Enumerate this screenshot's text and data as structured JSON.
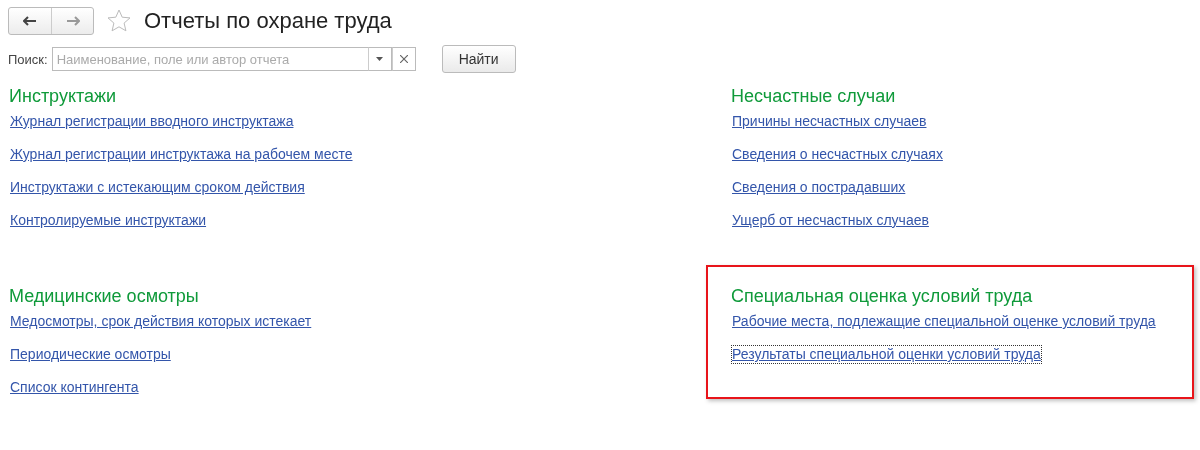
{
  "window": {
    "title": "Отчеты по охране труда",
    "favorite": false
  },
  "search": {
    "label": "Поиск:",
    "placeholder": "Наименование, поле или автор отчета",
    "button": "Найти"
  },
  "groups": [
    {
      "title": "Инструктажи",
      "highlighted": false,
      "links": [
        {
          "text": "Журнал регистрации вводного инструктажа",
          "focused": false
        },
        {
          "text": "Журнал регистрации инструктажа на рабочем месте",
          "focused": false
        },
        {
          "text": "Инструктажи с истекающим сроком действия",
          "focused": false
        },
        {
          "text": "Контролируемые инструктажи",
          "focused": false
        }
      ]
    },
    {
      "title": "Несчастные случаи",
      "highlighted": false,
      "links": [
        {
          "text": "Причины несчастных случаев",
          "focused": false
        },
        {
          "text": "Сведения о несчастных случаях",
          "focused": false
        },
        {
          "text": "Сведения о пострадавших",
          "focused": false
        },
        {
          "text": "Ущерб от несчастных случаев",
          "focused": false
        }
      ]
    },
    {
      "title": "Медицинские осмотры",
      "highlighted": false,
      "links": [
        {
          "text": "Медосмотры, срок действия которых истекает",
          "focused": false
        },
        {
          "text": "Периодические осмотры",
          "focused": false
        },
        {
          "text": "Список контингента",
          "focused": false
        }
      ]
    },
    {
      "title": "Специальная оценка условий труда",
      "highlighted": true,
      "links": [
        {
          "text": "Рабочие места, подлежащие специальной оценке условий труда",
          "focused": false
        },
        {
          "text": "Результаты специальной оценки условий труда",
          "focused": true
        }
      ]
    }
  ]
}
